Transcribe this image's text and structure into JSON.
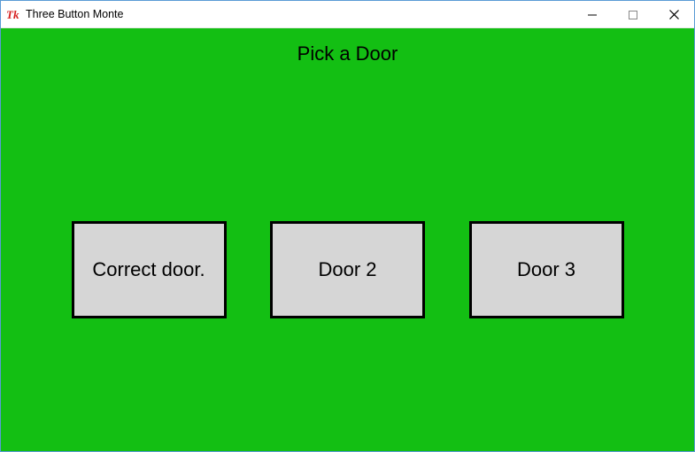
{
  "window": {
    "title": "Three Button Monte"
  },
  "prompt": "Pick a Door",
  "doors": {
    "door1_label": "Correct door.",
    "door2_label": "Door 2",
    "door3_label": "Door 3"
  }
}
